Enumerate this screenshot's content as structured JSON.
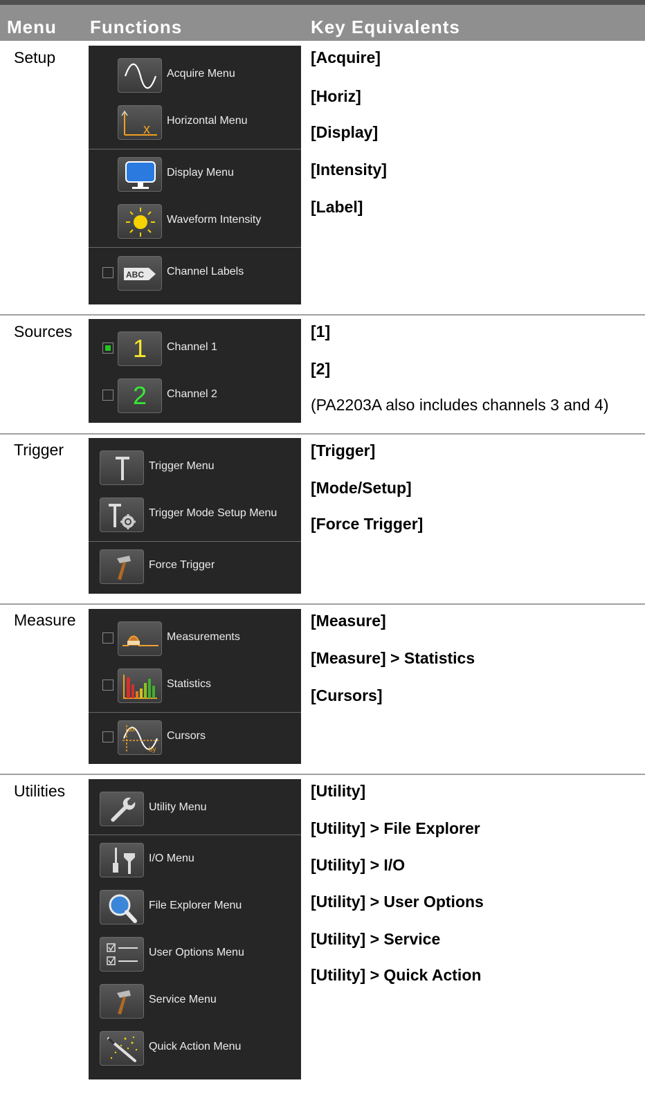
{
  "header": {
    "menu": "Menu",
    "functions": "Functions",
    "key_equivalents": "Key Equivalents"
  },
  "colors": {
    "header_bg": "#8f8f8f",
    "panel_bg": "#262626",
    "rule": "#a0a0a0"
  },
  "sections": {
    "setup": {
      "name": "Setup",
      "items": [
        {
          "label": "Acquire Menu",
          "icon": "sine-wave-icon"
        },
        {
          "label": "Horizontal Menu",
          "icon": "horizontal-axis-icon"
        },
        {
          "label": "Display Menu",
          "icon": "monitor-icon"
        },
        {
          "label": "Waveform Intensity",
          "icon": "sun-icon"
        },
        {
          "label": "Channel Labels",
          "icon": "abc-label-icon",
          "checked": false
        }
      ],
      "keys": [
        "[Acquire]",
        "[Horiz]",
        "[Display]",
        "[Intensity]",
        "[Label]"
      ]
    },
    "sources": {
      "name": "Sources",
      "items": [
        {
          "label": "Channel 1",
          "icon_text": "1",
          "icon": "channel-1-icon",
          "checked": true
        },
        {
          "label": "Channel 2",
          "icon_text": "2",
          "icon": "channel-2-icon",
          "checked": false
        }
      ],
      "keys": [
        "[1]",
        "[2]"
      ],
      "note": "(PA2203A also includes channels 3 and 4)"
    },
    "trigger": {
      "name": "Trigger",
      "items": [
        {
          "label": "Trigger Menu",
          "icon": "trigger-t-icon"
        },
        {
          "label": "Trigger Mode Setup Menu",
          "icon": "trigger-gear-icon"
        },
        {
          "label": "Force Trigger",
          "icon": "hammer-icon"
        }
      ],
      "keys": [
        "[Trigger]",
        "[Mode/Setup]",
        "[Force Trigger]"
      ]
    },
    "measure": {
      "name": "Measure",
      "items": [
        {
          "label": "Measurements",
          "icon": "measurement-pulse-icon",
          "checked": false
        },
        {
          "label": "Statistics",
          "icon": "bar-chart-icon",
          "checked": false
        },
        {
          "label": "Cursors",
          "icon": "cursors-icon",
          "checked": false
        }
      ],
      "keys": [
        "[Measure]",
        "[Measure] > Statistics",
        "[Cursors]"
      ]
    },
    "utilities": {
      "name": "Utilities",
      "items": [
        {
          "label": "Utility Menu",
          "icon": "wrench-icon"
        },
        {
          "label": "I/O Menu",
          "icon": "io-connector-icon"
        },
        {
          "label": "File Explorer Menu",
          "icon": "magnifier-icon"
        },
        {
          "label": "User Options Menu",
          "icon": "checklist-icon"
        },
        {
          "label": "Service Menu",
          "icon": "hammer-icon"
        },
        {
          "label": "Quick Action Menu",
          "icon": "magic-wand-icon"
        }
      ],
      "keys": [
        "[Utility]",
        "[Utility] > File Explorer",
        "[Utility] > I/O",
        "[Utility] > User Options",
        "[Utility] > Service",
        "[Utility] > Quick Action"
      ]
    }
  }
}
